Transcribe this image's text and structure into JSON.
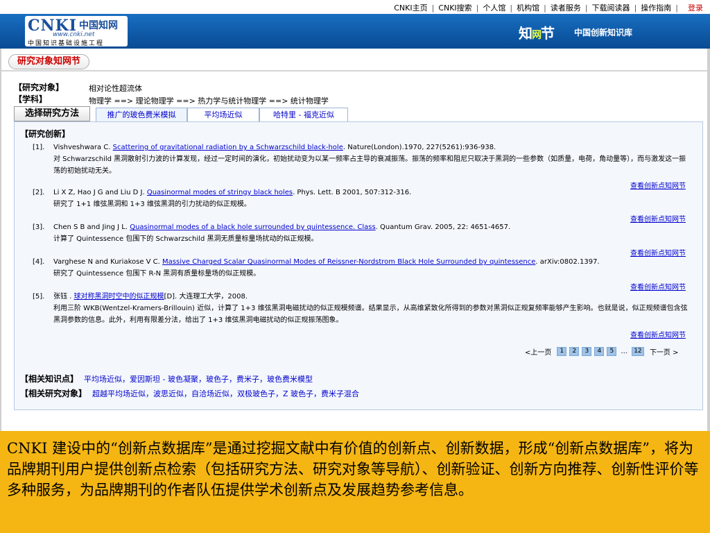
{
  "topnav": {
    "items": [
      "CNKI主页",
      "CNKI搜索",
      "个人馆",
      "机构馆",
      "读者服务",
      "下载阅读器",
      "操作指南"
    ],
    "login": "登录"
  },
  "banner": {
    "logo_main": "CNKI",
    "logo_cn": "中国知网",
    "logo_url": "www.cnki.net",
    "logo_sub": "中国知识基础设施工程",
    "zhi_logo_left": "知",
    "zhi_logo_mid": "网",
    "zhi_logo_right": "节",
    "title": "中国创新知识库"
  },
  "section_tag": "研究对象知网节",
  "info": {
    "object_label": "【研究对象】",
    "object_value": "相对论性超流体",
    "subject_label": "【学科】",
    "subject_value": "物理学 ==> 理论物理学 ==> 热力学与统计物理学 ==> 统计物理学"
  },
  "tabs": {
    "method": "选择研究方法",
    "items": [
      "推广的玻色费米模拟",
      "平均场近似",
      "哈特里 - 福克近似"
    ]
  },
  "panel": {
    "heading": "【研究创新】",
    "view_link": "查看创新点知网节",
    "refs": [
      {
        "num": "[1].",
        "authors": "Vishveshwara C.",
        "title": "Scattering of gravitational radiation by a Schwarzschild black-hole",
        "source": ". Nature(London).1970, 227(5261):936-938.",
        "desc": "对 Schwarzschild 黑洞散射引力波的计算发现，经过一定时间的演化，初始扰动变为以某一频率占主导的衰减振荡。振荡的频率和阻尼只取决于黑洞的一些参数（如质量，电荷，角动量等），而与激发这一振荡的初始扰动无关。"
      },
      {
        "num": "[2].",
        "authors": "Li X Z, Hao J G and Liu D J.",
        "title": "Quasinormal modes of stringy black holes",
        "source": ". Phys. Lett. B 2001, 507:312-316.",
        "desc": "研究了 1+1 维弦黑洞和 1+3 维弦黑洞的引力扰动的似正规模。"
      },
      {
        "num": "[3].",
        "authors": "Chen S B and Jing J L.",
        "title": "Quasinormal modes of a black hole surrounded by quintessence. Class",
        "source": ". Quantum Grav. 2005, 22: 4651-4657.",
        "desc": "计算了 Quintessence 包围下的 Schwarzschild 黑洞无质量标量场扰动的似正规模。"
      },
      {
        "num": "[4].",
        "authors": "Varghese N and Kuriakose V C.",
        "title": "Massive Charged Scalar Quasinormal Modes of Reissner-Nordstrom Black Hole Surrounded by quintessence",
        "source": ". arXiv:0802.1397.",
        "desc": "研究了 Quintessence 包围下 R-N 黑洞有质量标量场的似正规模。"
      },
      {
        "num": "[5].",
        "authors": "张钰 .",
        "title": "球对称黑洞时空中的似正规模",
        "source": "[D]. 大连理工大学，2008.",
        "desc": "利用三阶 WKB(Wentzel-Kramers-Brillouin) 近似，计算了 1+3 维弦黑洞电磁扰动的似正规模频谱。结果显示，从高维紧致化所得到的参数对黑洞似正规复频率能够产生影响。也就是说，似正规频谱包含弦黑洞参数的信息。此外，利用有限差分法，给出了 1+3 维弦黑洞电磁扰动的似正规振荡图象。"
      }
    ],
    "pager": {
      "prev": "<上一页",
      "pages": [
        "1",
        "2",
        "3",
        "4",
        "5"
      ],
      "ellipsis": "...",
      "last": "12",
      "next": "下一页 >"
    },
    "related_points_label": "【相关知识点】",
    "related_points": "平均场近似，爱因斯坦 - 玻色凝聚，玻色子，费米子，玻色费米模型",
    "related_objects_label": "【相关研究对象】",
    "related_objects": "超越平均场近似，波思近似，自洽场近似，双极玻色子，Z 玻色子，费米子混合"
  },
  "caption": "CNKI 建设中的“创新点数据库”是通过挖掘文献中有价值的创新点、创新数据，形成“创新点数据库”，将为品牌期刊用户提供创新点检索（包括研究方法、研究对象等导航）、创新验证、创新方向推荐、创新性评价等多种服务，为品牌期刊的作者队伍提供学术创新点及发展趋势参考信息。",
  "colors": {
    "banner": "#0f5aa8",
    "link": "#0000cc",
    "caption_bg": "#f5b614",
    "login": "#cc0000"
  }
}
